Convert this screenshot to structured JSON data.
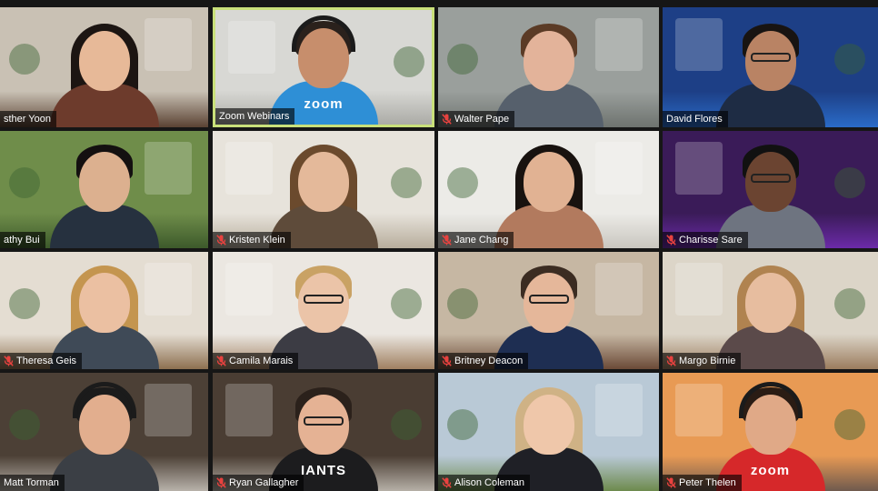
{
  "colors": {
    "active_border": "#c9e07a",
    "muted_icon": "#e8423f",
    "background": "#161616"
  },
  "participants": [
    {
      "name": "sther Yoon",
      "muted": false,
      "active": false,
      "wall": "#c9c1b4",
      "floor": "#5a4233",
      "body": "#6d3b2c",
      "skin": "#e7b998",
      "hair": "#1c1512",
      "hairStyle": "long",
      "extra": "",
      "shirtText": ""
    },
    {
      "name": "Zoom Webinars",
      "muted": false,
      "active": true,
      "wall": "#d8d8d4",
      "floor": "#ababa6",
      "body": "#2e8fd6",
      "skin": "#c78e6c",
      "hair": "#2a211c",
      "hairStyle": "short",
      "extra": "headset",
      "shirtText": "zoom"
    },
    {
      "name": "Walter Pape",
      "muted": true,
      "active": false,
      "wall": "#9a9f9c",
      "floor": "#6e736f",
      "body": "#56606c",
      "skin": "#e3b39a",
      "hair": "#5b3b26",
      "hairStyle": "short",
      "extra": "",
      "shirtText": ""
    },
    {
      "name": "David Flores",
      "muted": false,
      "active": false,
      "wall": "#1d3f86",
      "floor": "#2a6bc8",
      "body": "#1e2c44",
      "skin": "#b98364",
      "hair": "#181412",
      "hairStyle": "short",
      "extra": "glasses",
      "shirtText": ""
    },
    {
      "name": "athy Bui",
      "muted": false,
      "active": false,
      "wall": "#6f8d4a",
      "floor": "#3d5a2b",
      "body": "#26313f",
      "skin": "#dcb08f",
      "hair": "#141010",
      "hairStyle": "short",
      "extra": "",
      "shirtText": ""
    },
    {
      "name": "Kristen Klein",
      "muted": true,
      "active": false,
      "wall": "#e7e3db",
      "floor": "#b7ad9c",
      "body": "#5e4b3a",
      "skin": "#e4b99a",
      "hair": "#6b4a2d",
      "hairStyle": "long",
      "extra": "",
      "shirtText": ""
    },
    {
      "name": "Jane Chang",
      "muted": true,
      "active": false,
      "wall": "#ecebe7",
      "floor": "#c9c6bf",
      "body": "#b27a5e",
      "skin": "#e1b293",
      "hair": "#18120f",
      "hairStyle": "long",
      "extra": "",
      "shirtText": ""
    },
    {
      "name": "Charisse Sare",
      "muted": true,
      "active": false,
      "wall": "#3a1b58",
      "floor": "#6b2aa8",
      "body": "#6e7480",
      "skin": "#6b4431",
      "hair": "#111",
      "hairStyle": "short",
      "extra": "glasses",
      "shirtText": ""
    },
    {
      "name": "Theresa Geis",
      "muted": true,
      "active": false,
      "wall": "#e4ddd2",
      "floor": "#8d7050",
      "body": "#3f4a57",
      "skin": "#ebc0a2",
      "hair": "#c4954f",
      "hairStyle": "long",
      "extra": "",
      "shirtText": ""
    },
    {
      "name": "Camila Marais",
      "muted": true,
      "active": false,
      "wall": "#ebe7e1",
      "floor": "#a08061",
      "body": "#3c3c44",
      "skin": "#ebc4a8",
      "hair": "#c9a264",
      "hairStyle": "short",
      "extra": "glasses",
      "shirtText": ""
    },
    {
      "name": "Britney Deacon",
      "muted": true,
      "active": false,
      "wall": "#c6b7a3",
      "floor": "#6b4a37",
      "body": "#1e2e52",
      "skin": "#e5b79a",
      "hair": "#3b2c22",
      "hairStyle": "short",
      "extra": "glasses",
      "shirtText": ""
    },
    {
      "name": "Margo Birnie",
      "muted": true,
      "active": false,
      "wall": "#dcd5c8",
      "floor": "#9b7c5e",
      "body": "#5b4a4a",
      "skin": "#e7bd9f",
      "hair": "#b08350",
      "hairStyle": "long",
      "extra": "",
      "shirtText": ""
    },
    {
      "name": "Matt Torman",
      "muted": false,
      "active": false,
      "wall": "#4c4036",
      "floor": "#b8b2aa",
      "body": "#3b3f45",
      "skin": "#e2ae8e",
      "hair": "#1b1b1b",
      "hairStyle": "short",
      "extra": "headset",
      "shirtText": ""
    },
    {
      "name": "Ryan Gallagher",
      "muted": true,
      "active": false,
      "wall": "#4a3d33",
      "floor": "#b6b0a7",
      "body": "#1c1c1e",
      "skin": "#e5b294",
      "hair": "#2b211b",
      "hairStyle": "short",
      "extra": "glasses",
      "shirtText": "IANTS"
    },
    {
      "name": "Alison Coleman",
      "muted": true,
      "active": false,
      "wall": "#b9c9d6",
      "floor": "#6d8a4d",
      "body": "#1f2026",
      "skin": "#efc7aa",
      "hair": "#cfb285",
      "hairStyle": "long",
      "extra": "",
      "shirtText": ""
    },
    {
      "name": "Peter Thelen",
      "muted": true,
      "active": false,
      "wall": "#e89a54",
      "floor": "#6f5a4e",
      "body": "#d6282a",
      "skin": "#e0a987",
      "hair": "#2a1c14",
      "hairStyle": "short",
      "extra": "headset",
      "shirtText": "zoom"
    }
  ]
}
